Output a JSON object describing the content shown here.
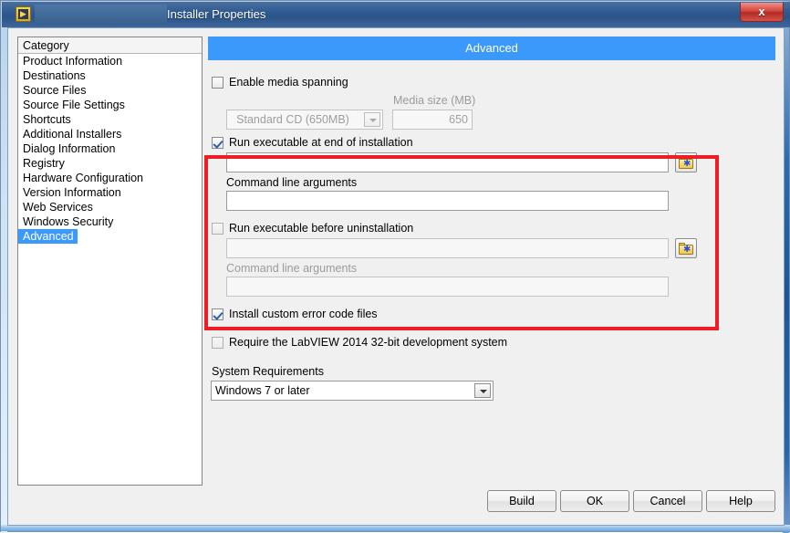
{
  "window": {
    "title": "Installer Properties",
    "close_label": "x",
    "app_icon": "labview-icon"
  },
  "sidebar": {
    "header": "Category",
    "items": [
      {
        "label": "Product Information",
        "selected": false
      },
      {
        "label": "Destinations",
        "selected": false
      },
      {
        "label": "Source Files",
        "selected": false
      },
      {
        "label": "Source File Settings",
        "selected": false
      },
      {
        "label": "Shortcuts",
        "selected": false
      },
      {
        "label": "Additional Installers",
        "selected": false
      },
      {
        "label": "Dialog Information",
        "selected": false
      },
      {
        "label": "Registry",
        "selected": false
      },
      {
        "label": "Hardware Configuration",
        "selected": false
      },
      {
        "label": "Version Information",
        "selected": false
      },
      {
        "label": "Web Services",
        "selected": false
      },
      {
        "label": "Windows Security",
        "selected": false
      },
      {
        "label": "Advanced",
        "selected": true
      }
    ]
  },
  "panel": {
    "header": "Advanced",
    "media_spanning": {
      "checkbox_label": "Enable media spanning",
      "checked": false,
      "media_type_value": "Standard CD (650MB)",
      "media_size_label": "Media size (MB)",
      "media_size_value": "650"
    },
    "run_at_end": {
      "checkbox_label": "Run executable at end of installation",
      "checked": true,
      "path_value": "",
      "args_label": "Command line arguments",
      "args_value": "",
      "browse_icon": "folder-browse-icon"
    },
    "run_before_uninstall": {
      "checkbox_label": "Run executable before uninstallation",
      "checked": false,
      "path_value": "",
      "args_label": "Command line arguments",
      "args_value": "",
      "browse_icon": "folder-browse-icon"
    },
    "install_error_codes": {
      "checkbox_label": "Install custom error code files",
      "checked": true
    },
    "require_labview": {
      "checkbox_label": "Require the LabVIEW 2014 32-bit development system",
      "checked": false
    },
    "system_requirements": {
      "label": "System Requirements",
      "value": "Windows 7 or later"
    }
  },
  "footer": {
    "build_label": "Build",
    "ok_label": "OK",
    "cancel_label": "Cancel",
    "help_label": "Help"
  },
  "annotation": {
    "highlight_color": "#ee1d23"
  }
}
